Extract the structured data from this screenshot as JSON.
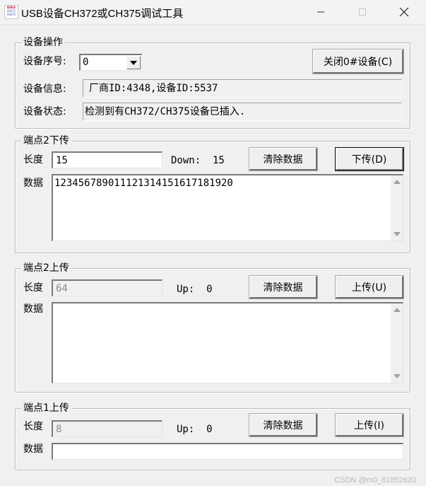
{
  "window": {
    "title": "USB设备CH372或CH375调试工具",
    "icon_text": [
      "DEBUG",
      "CH372",
      "CH375"
    ]
  },
  "device_group": {
    "label": "设备操作",
    "index_label": "设备序号:",
    "index_value": "0",
    "close_button": "关闭0#设备(C)",
    "info_label": "设备信息:",
    "info_value": "厂商ID:4348,设备ID:5537",
    "status_label": "设备状态:",
    "status_value": "检测到有CH372/CH375设备已插入."
  },
  "ep2_down": {
    "label": "端点2下传",
    "length_label": "长度",
    "length_value": "15",
    "count_text": "Down:  15",
    "clear_button": "清除数据",
    "send_button": "下传(D)",
    "data_label": "数据",
    "data_value": "123456789011121314151617181920"
  },
  "ep2_up": {
    "label": "端点2上传",
    "length_label": "长度",
    "length_value": "64",
    "count_text": "Up:  0",
    "clear_button": "清除数据",
    "recv_button": "上传(U)",
    "data_label": "数据",
    "data_value": ""
  },
  "ep1_up": {
    "label": "端点1上传",
    "length_label": "长度",
    "length_value": "8",
    "count_text": "Up:  0",
    "clear_button": "清除数据",
    "recv_button": "上传(I)",
    "data_label": "数据",
    "data_value": ""
  },
  "watermark": "CSDN @m0_61852620"
}
